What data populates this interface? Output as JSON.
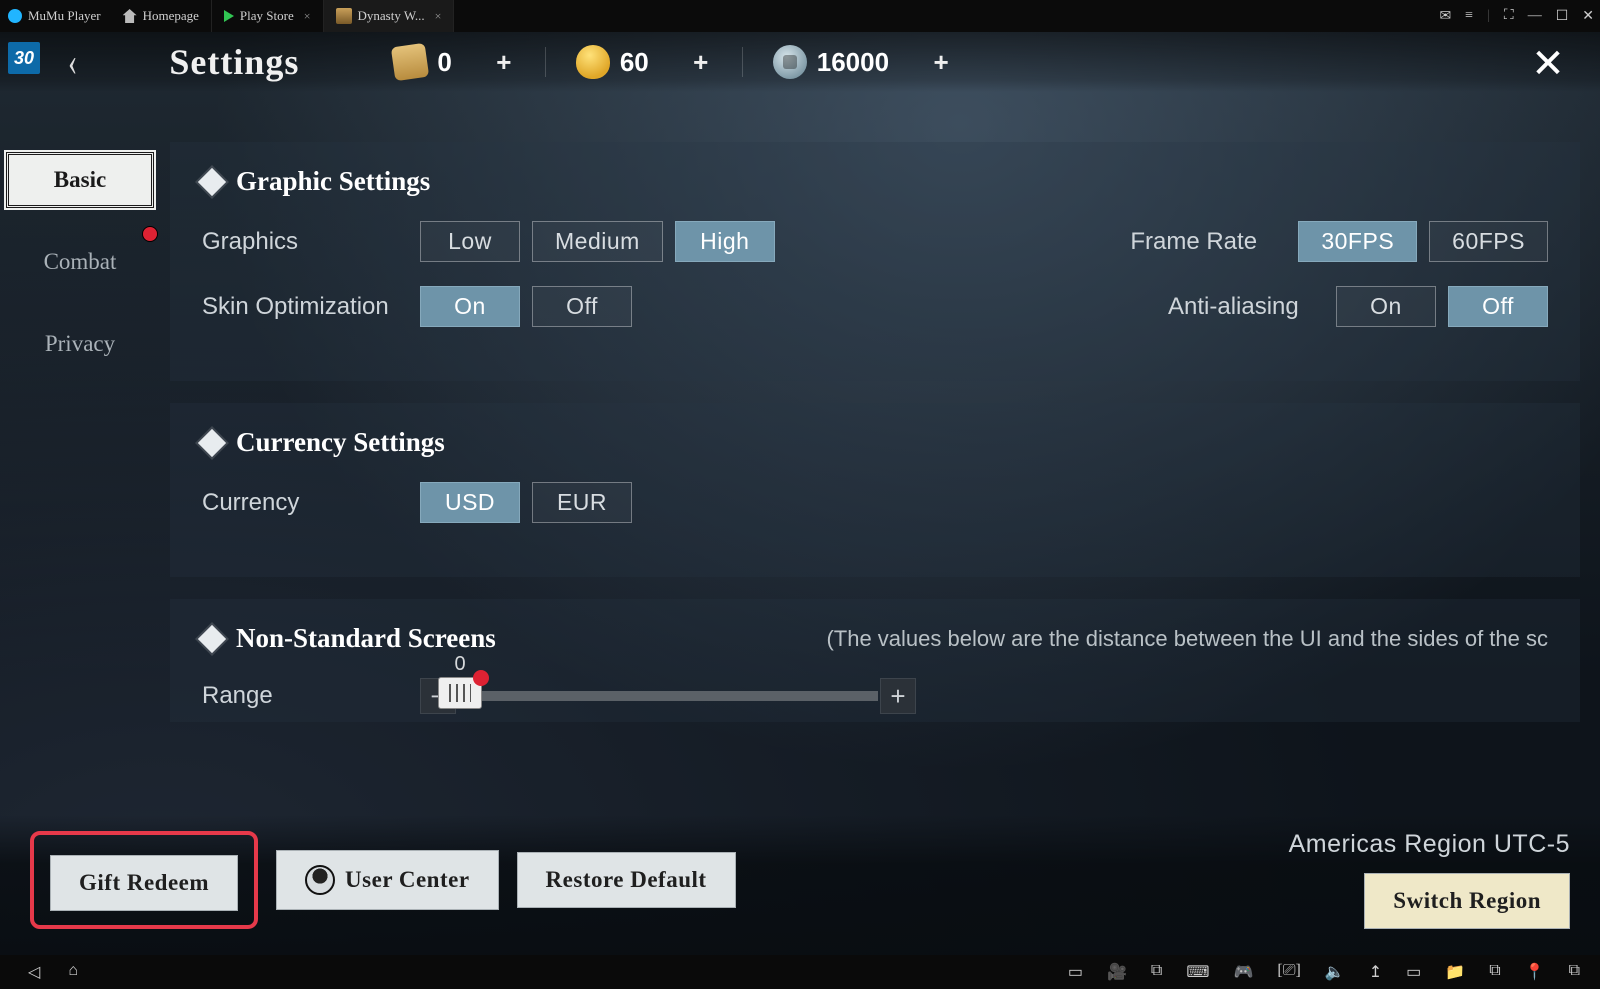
{
  "emulator": {
    "brand": "MuMu Player",
    "tabs": [
      {
        "label": "Homepage"
      },
      {
        "label": "Play Store"
      },
      {
        "label": "Dynasty W..."
      }
    ],
    "winctrl": {
      "mail": "✉",
      "menu": "≡",
      "full": "⛶",
      "min": "—",
      "max": "☐",
      "close": "✕"
    },
    "bottom": {
      "back": "◁",
      "home": "⌂",
      "tools": [
        "▭",
        "🎥",
        "⧉",
        "⌨",
        "🎮",
        "[⎚]",
        "🔈",
        "↥",
        "▭",
        "📁",
        "⧉",
        "📍",
        "⧉"
      ]
    }
  },
  "hud": {
    "level": "30",
    "title": "Settings",
    "currencies": [
      {
        "key": "ticket",
        "value": "0"
      },
      {
        "key": "gold",
        "value": "60"
      },
      {
        "key": "coin",
        "value": "16000"
      }
    ]
  },
  "sidebar": [
    {
      "key": "basic",
      "label": "Basic",
      "active": true
    },
    {
      "key": "combat",
      "label": "Combat",
      "alert": true
    },
    {
      "key": "privacy",
      "label": "Privacy"
    }
  ],
  "panels": {
    "graphic": {
      "title": "Graphic Settings",
      "rows": {
        "graphics": {
          "label": "Graphics",
          "opts": [
            "Low",
            "Medium",
            "High"
          ],
          "sel": "High",
          "right_label": "Frame Rate",
          "right_opts": [
            "30FPS",
            "60FPS"
          ],
          "right_sel": "30FPS"
        },
        "skin": {
          "label": "Skin Optimization",
          "opts": [
            "On",
            "Off"
          ],
          "sel": "On",
          "right_label": "Anti-aliasing",
          "right_opts": [
            "On",
            "Off"
          ],
          "right_sel": "Off"
        }
      }
    },
    "currency": {
      "title": "Currency Settings",
      "row": {
        "label": "Currency",
        "opts": [
          "USD",
          "EUR"
        ],
        "sel": "USD"
      }
    },
    "screens": {
      "title": "Non-Standard Screens",
      "hint": "(The values below are the distance between the UI and the sides of the sc",
      "row": {
        "label": "Range",
        "value": "0"
      }
    }
  },
  "footer": {
    "gift": "Gift Redeem",
    "user_center": "User Center",
    "restore": "Restore Default",
    "region": "Americas Region  UTC-5",
    "switch": "Switch Region"
  }
}
